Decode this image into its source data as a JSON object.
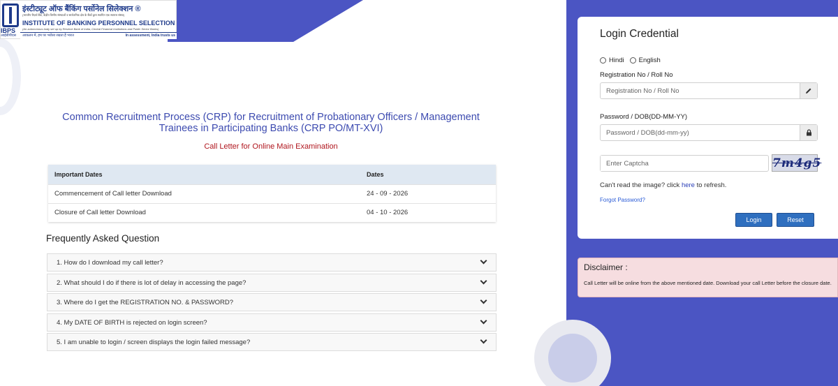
{
  "header": {
    "logo": {
      "hindi_name": "इंस्टीट्यूट ऑफ बैंकिंग पर्सोनेल सिलेक्शन ®",
      "hindi_subtitle": "(भारतीय रिज़र्व बैंक, केंद्रीय वित्तीय संस्थाओं व सार्वजनिक क्षेत्र के बैंकों द्वारा स्थापित एक स्वायत्त संस्था)",
      "english_name": "INSTITUTE OF BANKING PERSONNEL SELECTION",
      "english_subtitle": "(An autonomous body set up by Reserve Bank of India, Central Financial Institutions and Public Sector Banks)",
      "tagline_hindi": "आकलन में, हम पर भरोसा रखता है भारत",
      "tagline_english": "In assessment, India trusts us",
      "abbr": "IBPS",
      "abbr_sub": "आईबीपीएस"
    }
  },
  "main": {
    "title": "Common Recruitment Process (CRP) for Recruitment of Probationary Officers / Management Trainees in Participating Banks (CRP PO/MT-XVI)",
    "subtitle": "Call Letter for Online Main Examination",
    "table": {
      "headers": [
        "Important Dates",
        "Dates"
      ],
      "rows": [
        [
          "Commencement of Call letter Download",
          "24 - 09 - 2026"
        ],
        [
          "Closure of Call letter Download",
          "04 - 10 - 2026"
        ]
      ]
    },
    "faq": {
      "title": "Frequently Asked Question",
      "items": [
        "1. How do I download my call letter?",
        "2. What should I do if there is lot of delay in accessing the page?",
        "3. Where do I get the REGISTRATION NO. & PASSWORD?",
        "4. My DATE OF BIRTH is rejected on login screen?",
        "5. I am unable to login / screen displays the login failed message?"
      ]
    }
  },
  "login": {
    "title": "Login Credential",
    "languages": [
      "Hindi",
      "English"
    ],
    "reg_label": "Registration No / Roll No",
    "reg_placeholder": "Registration No / Roll No",
    "reg_icon": "pencil-icon",
    "pwd_label": "Password / DOB(DD-MM-YY)",
    "pwd_placeholder": "Password / DOB(dd-mm-yy)",
    "pwd_icon": "lock-icon",
    "captcha_placeholder": "Enter Captcha",
    "captcha_text": "7m4g5",
    "refresh_prefix": "Can't read the image? click",
    "refresh_link": "here",
    "refresh_suffix": "to refresh.",
    "forgot": "Forgot Password?",
    "login_button": "Login",
    "reset_button": "Reset"
  },
  "disclaimer": {
    "title": "Disclaimer :",
    "text": "Call Letter will be online from the above mentioned date. Download your call Letter before the closure date."
  },
  "colors": {
    "brand_blue": "#4b55c3",
    "title_blue": "#3d4bb0",
    "subtitle_red": "#b0161e",
    "button_blue": "#2f6fbf",
    "disclaimer_bg": "#f6dde0"
  }
}
